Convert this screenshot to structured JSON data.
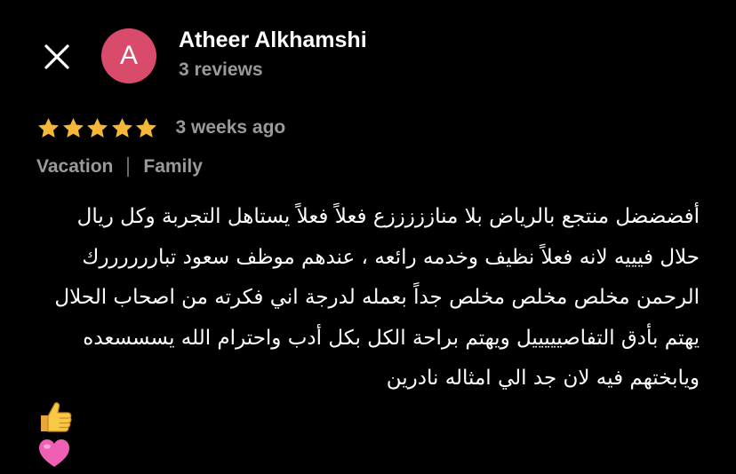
{
  "header": {
    "close_icon": "close-icon",
    "avatar_letter": "A",
    "avatar_color": "#d84b6b",
    "reviewer_name": "Atheer Alkhamshi",
    "reviews_count": "3 reviews"
  },
  "rating": {
    "stars": 5,
    "max_stars": 5,
    "star_color": "#f4b738",
    "date": "3 weeks ago"
  },
  "tags": [
    "Vacation",
    "Family"
  ],
  "review": {
    "text": "أفضضضل منتجع بالرياض بلا منازززززع فعلاً فعلاً يستاهل التجربة وكل ريال حلال فيييه لانه فعلاً نظيف وخدمه رائعه ، عندهم موظف سعود تباررررررك الرحمن مخلص مخلص مخلص جداً بعمله لدرجة اني فكرته من اصحاب الحلال يهتم بأدق التفاصيييييل ويهتم براحة الكل بكل أدب واحترام الله يسسسعده ويابختهم فيه لان جد الي امثاله نادرين",
    "emojis": [
      "thumbs-up-icon",
      "heart-icon"
    ]
  }
}
